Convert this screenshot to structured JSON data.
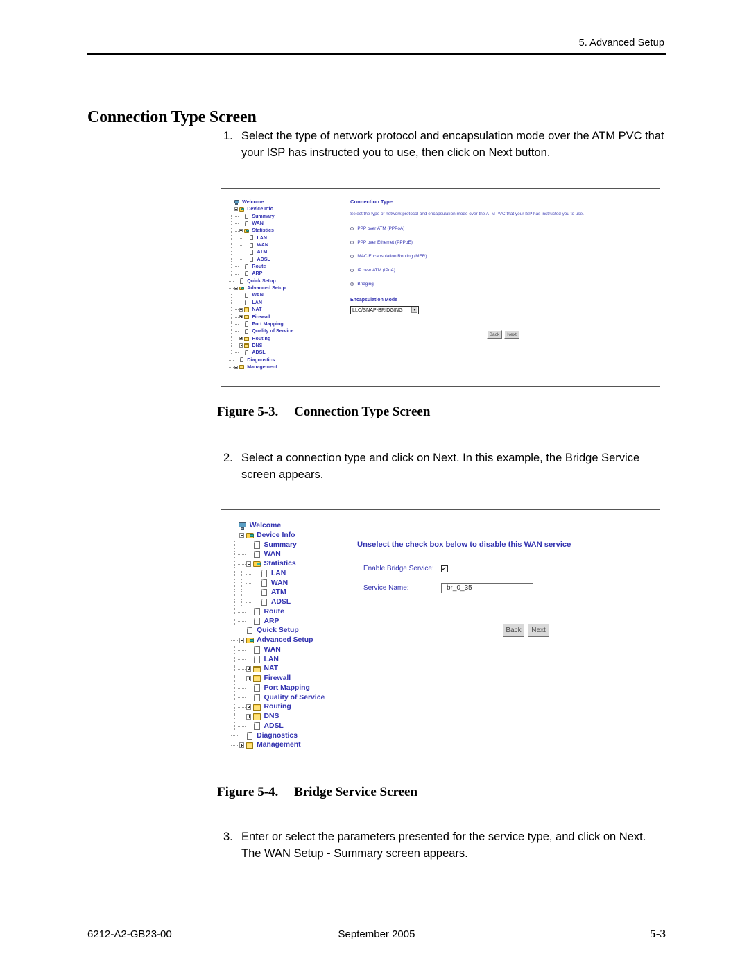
{
  "header": {
    "running_head": "5. Advanced Setup"
  },
  "section": {
    "title": "Connection Type Screen"
  },
  "steps": [
    {
      "number": "1.",
      "text": "Select the type of network protocol and encapsulation mode over the ATM PVC that your ISP has instructed you to use, then click on Next button."
    },
    {
      "number": "2.",
      "text": "Select a connection type and click on Next. In this example, the Bridge Service screen appears."
    },
    {
      "number": "3.",
      "text": "Enter or select the parameters presented for the service type, and click on Next. The WAN Setup - Summary screen appears."
    }
  ],
  "captions": [
    {
      "label": "Figure 5-3.",
      "text": "Connection Type Screen"
    },
    {
      "label": "Figure 5-4.",
      "text": "Bridge Service Screen"
    }
  ],
  "tree": {
    "items": [
      {
        "label": "Welcome",
        "depth": 0,
        "icon": "monitor",
        "expander": "none"
      },
      {
        "label": "Device Info",
        "depth": 1,
        "icon": "folder-open",
        "expander": "minus"
      },
      {
        "label": "Summary",
        "depth": 2,
        "icon": "page",
        "expander": "none"
      },
      {
        "label": "WAN",
        "depth": 2,
        "icon": "page",
        "expander": "none"
      },
      {
        "label": "Statistics",
        "depth": 2,
        "icon": "folder-open",
        "expander": "minus"
      },
      {
        "label": "LAN",
        "depth": 3,
        "icon": "page",
        "expander": "none"
      },
      {
        "label": "WAN",
        "depth": 3,
        "icon": "page",
        "expander": "none"
      },
      {
        "label": "ATM",
        "depth": 3,
        "icon": "page",
        "expander": "none"
      },
      {
        "label": "ADSL",
        "depth": 3,
        "icon": "page",
        "expander": "none"
      },
      {
        "label": "Route",
        "depth": 2,
        "icon": "page",
        "expander": "none"
      },
      {
        "label": "ARP",
        "depth": 2,
        "icon": "page",
        "expander": "none"
      },
      {
        "label": "Quick Setup",
        "depth": 1,
        "icon": "page",
        "expander": "none"
      },
      {
        "label": "Advanced Setup",
        "depth": 1,
        "icon": "folder-open",
        "expander": "minus"
      },
      {
        "label": "WAN",
        "depth": 2,
        "icon": "page",
        "expander": "none"
      },
      {
        "label": "LAN",
        "depth": 2,
        "icon": "page",
        "expander": "none"
      },
      {
        "label": "NAT",
        "depth": 2,
        "icon": "folder",
        "expander": "plus"
      },
      {
        "label": "Firewall",
        "depth": 2,
        "icon": "folder",
        "expander": "plus"
      },
      {
        "label": "Port Mapping",
        "depth": 2,
        "icon": "page",
        "expander": "none"
      },
      {
        "label": "Quality of Service",
        "depth": 2,
        "icon": "page",
        "expander": "none"
      },
      {
        "label": "Routing",
        "depth": 2,
        "icon": "folder",
        "expander": "plus"
      },
      {
        "label": "DNS",
        "depth": 2,
        "icon": "folder",
        "expander": "plus"
      },
      {
        "label": "ADSL",
        "depth": 2,
        "icon": "page",
        "expander": "none"
      },
      {
        "label": "Diagnostics",
        "depth": 1,
        "icon": "page",
        "expander": "none"
      },
      {
        "label": "Management",
        "depth": 1,
        "icon": "folder",
        "expander": "plus"
      }
    ]
  },
  "figure1": {
    "panel_title": "Connection Type",
    "panel_description": "Select the type of network protocol and encapsulation mode over the ATM PVC that your ISP has instructed you to use.",
    "options": [
      {
        "label": "PPP over ATM (PPPoA)",
        "selected": false
      },
      {
        "label": "PPP over Ethernet (PPPoE)",
        "selected": false
      },
      {
        "label": "MAC Encapsulation Routing (MER)",
        "selected": false
      },
      {
        "label": "IP over ATM (IPoA)",
        "selected": false
      },
      {
        "label": "Bridging",
        "selected": true
      }
    ],
    "encapsulation_label": "Encapsulation Mode",
    "encapsulation_value": "LLC/SNAP-BRIDGING",
    "back_label": "Back",
    "next_label": "Next"
  },
  "figure2": {
    "panel_title": "Unselect the check box below to disable this WAN service",
    "enable_label": "Enable Bridge Service:",
    "enable_checked": true,
    "service_name_label": "Service Name:",
    "service_name_value": "br_0_35",
    "back_label": "Back",
    "next_label": "Next"
  },
  "footer": {
    "doc_number": "6212-A2-GB23-00",
    "date": "September 2005",
    "page": "5-3"
  }
}
